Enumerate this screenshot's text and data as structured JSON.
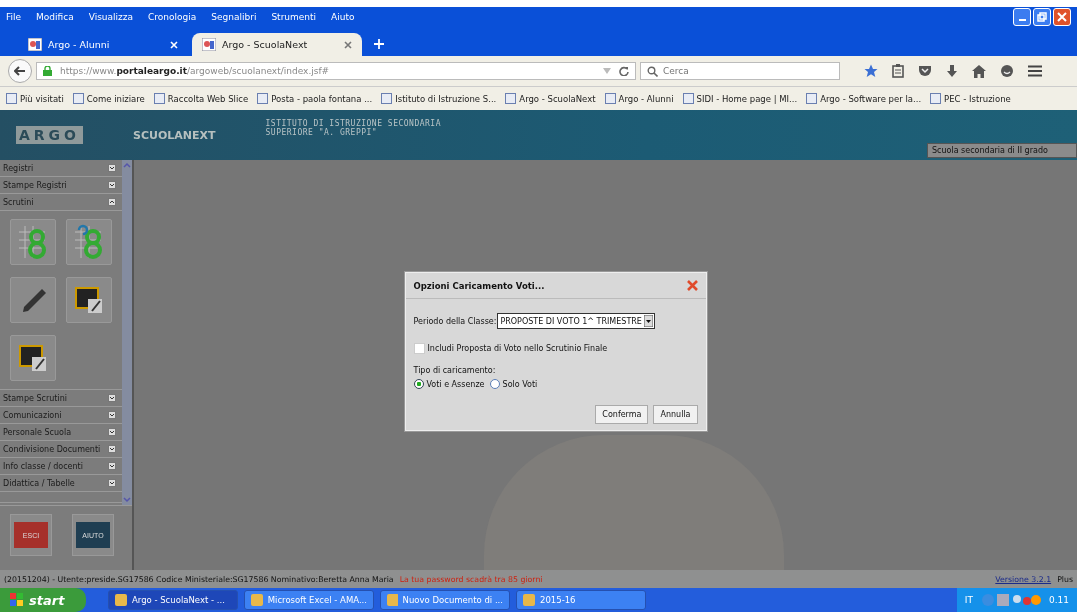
{
  "menu": [
    "File",
    "Modifica",
    "Visualizza",
    "Cronologia",
    "Segnalibri",
    "Strumenti",
    "Aiuto"
  ],
  "tabs": [
    {
      "label": "Argo - Alunni",
      "selected": false
    },
    {
      "label": "Argo - ScuolaNext",
      "selected": true
    }
  ],
  "address": {
    "url": "https://www.**portaleargo.it**/argoweb/scuolanext/index.jsf#"
  },
  "search": {
    "placeholder": "Cerca"
  },
  "bookmarks": [
    {
      "label": "Più visitati"
    },
    {
      "label": "Come iniziare"
    },
    {
      "label": "Raccolta Web Slice"
    },
    {
      "label": "Posta - paola fontana ..."
    },
    {
      "label": "Istituto di Istruzione S..."
    },
    {
      "label": "Argo - ScuolaNext"
    },
    {
      "label": "Argo - Alunni"
    },
    {
      "label": "SIDI - Home page | MI..."
    },
    {
      "label": "Argo - Software per la..."
    },
    {
      "label": "PEC - Istruzione"
    }
  ],
  "header": {
    "logo": "ARGO",
    "product": "SCUOLANEXT",
    "institute": [
      "ISTITUTO DI ISTRUZIONE SECONDARIA",
      "SUPERIORE \"A. GREPPI\""
    ],
    "school": "Scuola secondaria di II grado"
  },
  "sidebar": {
    "sections": [
      {
        "label": "Registri",
        "expanded": false
      },
      {
        "label": "Stampe Registri",
        "expanded": false
      },
      {
        "label": "Scrutini",
        "expanded": true,
        "tools": [
          {
            "kind": "grid8"
          },
          {
            "kind": "refresh8"
          },
          {
            "kind": "pencil"
          },
          {
            "kind": "board"
          },
          {
            "kind": "board"
          }
        ]
      },
      {
        "label": "Stampe Scrutini",
        "expanded": false
      },
      {
        "label": "Comunicazioni",
        "expanded": false
      },
      {
        "label": "Personale Scuola",
        "expanded": false
      },
      {
        "label": "Condivisione Documenti",
        "expanded": false
      },
      {
        "label": "Info classe / docenti",
        "expanded": false
      },
      {
        "label": "Didattica / Tabelle",
        "expanded": false
      }
    ],
    "bottom_buttons": [
      {
        "label": "ESCI",
        "kind": "exit"
      },
      {
        "label": "AIUTO",
        "kind": "help"
      }
    ]
  },
  "dialog": {
    "title": "Opzioni Caricamento Voti...",
    "period_label": "Periodo della Classe:",
    "period_value": "PROPOSTE DI VOTO 1^ TRIMESTRE",
    "checkbox": {
      "label": "Includi Proposta di Voto nello Scrutinio Finale",
      "checked": false
    },
    "group_label": "Tipo di caricamento:",
    "radios": [
      {
        "label": "Voti e Assenze",
        "selected": true
      },
      {
        "label": "Solo Voti",
        "selected": false
      }
    ],
    "buttons": [
      "Conferma",
      "Annulla"
    ]
  },
  "status_bar": {
    "info": "(20151204) - Utente:preside.SG17586 Codice Ministeriale:SG17586 Nominativo:Beretta Anna Maria",
    "warning": "La tua password scadrà tra 85 giorni",
    "version": "Versione 3.2.1",
    "edition": "Plus"
  },
  "taskbar": {
    "start": "start",
    "tasks": [
      {
        "label": "Argo - ScuolaNext - ...",
        "selected": true
      },
      {
        "label": "Microsoft Excel - AMA...",
        "selected": false
      },
      {
        "label": "Nuovo Documento di ...",
        "selected": false
      },
      {
        "label": "2015-16",
        "selected": false
      }
    ],
    "language": "IT",
    "clock": "0.11"
  }
}
